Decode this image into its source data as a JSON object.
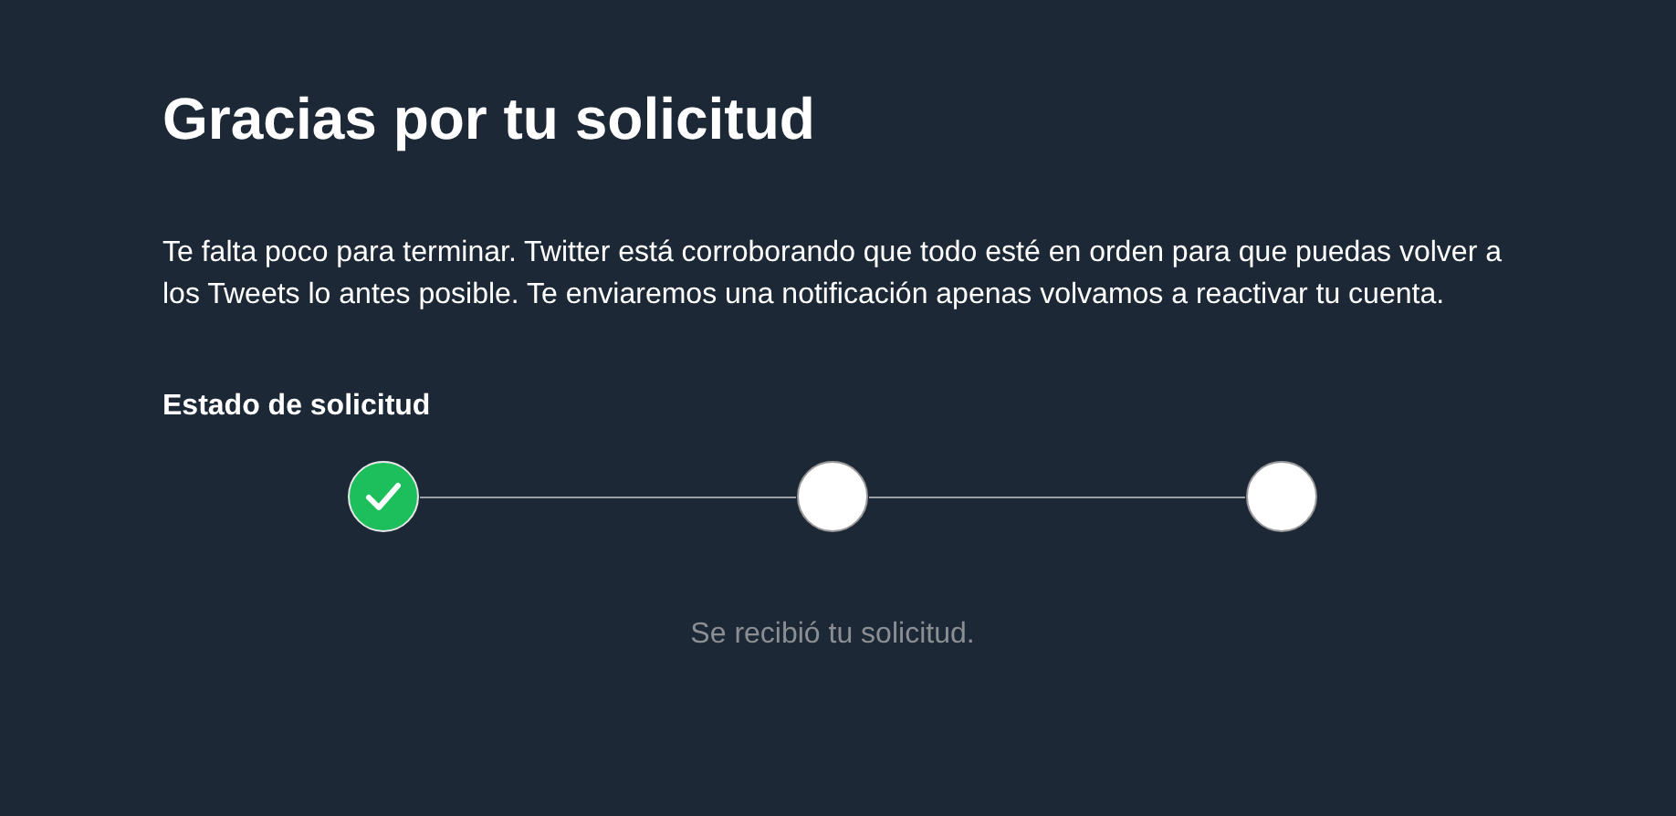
{
  "title": "Gracias por tu solicitud",
  "message": "Te falta poco para terminar. Twitter está corroborando que todo esté en orden para que puedas volver a los Tweets lo antes posible. Te enviaremos una notificación apenas volvamos a reactivar tu cuenta.",
  "status": {
    "heading": "Estado de solicitud",
    "steps": [
      {
        "completed": true
      },
      {
        "completed": false
      },
      {
        "completed": false
      }
    ],
    "caption": "Se recibió tu solicitud."
  }
}
